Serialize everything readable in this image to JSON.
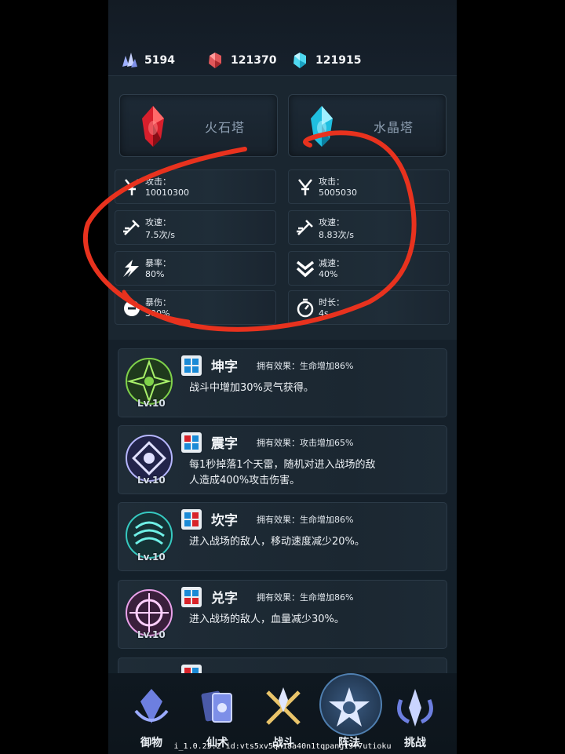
{
  "resources": [
    {
      "icon": "purple-crystal-icon",
      "value": "5194"
    },
    {
      "icon": "red-crystal-icon",
      "value": "121370"
    },
    {
      "icon": "cyan-crystal-icon",
      "value": "121915"
    }
  ],
  "towers": [
    {
      "icon": "fire-stone-icon",
      "name": "火石塔"
    },
    {
      "icon": "water-crystal-icon",
      "name": "水晶塔"
    }
  ],
  "stats_left": [
    {
      "icon": "sword-attack-icon",
      "label": "攻击：",
      "value": "10010300"
    },
    {
      "icon": "attack-speed-icon",
      "label": "攻速：",
      "value": "7.5次/s"
    },
    {
      "icon": "crit-rate-icon",
      "label": "暴率：",
      "value": "80%"
    },
    {
      "icon": "crit-damage-icon",
      "label": "暴伤：",
      "value": "300%"
    }
  ],
  "stats_right": [
    {
      "icon": "sword-attack-icon",
      "label": "攻击：",
      "value": "5005030"
    },
    {
      "icon": "attack-speed-icon",
      "label": "攻速：",
      "value": "8.83次/s"
    },
    {
      "icon": "slow-down-icon",
      "label": "减速：",
      "value": "40%"
    },
    {
      "icon": "stopwatch-icon",
      "label": "时长：",
      "value": "4s"
    }
  ],
  "glyphs": [
    {
      "name": "坤字",
      "level": "Lv.10",
      "effect": "拥有效果：生命增加86%",
      "desc": "战斗中增加30%灵气获得。",
      "color": "#7fd14a"
    },
    {
      "name": "震字",
      "level": "Lv.10",
      "effect": "拥有效果：攻击增加65%",
      "desc": "每1秒掉落1个天雷，随机对进入战场的敌人造成400%攻击伤害。",
      "color": "#b6b6ff"
    },
    {
      "name": "坎字",
      "level": "Lv.10",
      "effect": "拥有效果：生命增加86%",
      "desc": "进入战场的敌人，移动速度减少20%。",
      "color": "#36c9c0"
    },
    {
      "name": "兑字",
      "level": "Lv.10",
      "effect": "拥有效果：生命增加86%",
      "desc": "进入战场的敌人，血量减少30%。",
      "color": "#e9a0e9"
    }
  ],
  "nav": [
    {
      "icon": "defense-icon",
      "label": "御物"
    },
    {
      "icon": "spell-card-icon",
      "label": "仙术"
    },
    {
      "icon": "battle-icon",
      "label": "战斗"
    },
    {
      "icon": "formation-icon",
      "label": "阵法"
    },
    {
      "icon": "challenge-icon",
      "label": "挑战"
    }
  ],
  "version": "i_1.0.25.2 id:vts5xv5qn18a40n1tqpang19f7utioku",
  "colors": {
    "annotation": "#e8321e",
    "background": "#16202b"
  }
}
